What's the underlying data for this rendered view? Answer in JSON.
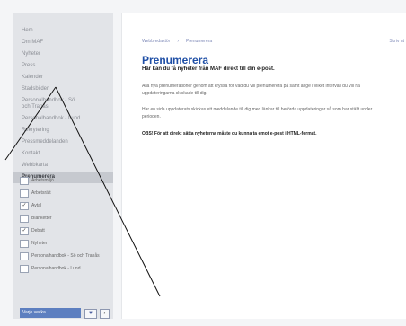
{
  "sidebar": {
    "items": [
      {
        "label": "Hem"
      },
      {
        "label": "Om MAF"
      },
      {
        "label": "Nyheter"
      },
      {
        "label": "Press"
      },
      {
        "label": "Kalender"
      },
      {
        "label": "Stadsbilder"
      },
      {
        "label": "Personalhandbok - Sö\noch Tranås"
      },
      {
        "label": "Personalhandbok - Lund"
      },
      {
        "label": "Rekrytering"
      },
      {
        "label": "Pressmeddelanden"
      },
      {
        "label": "Kontakt"
      },
      {
        "label": "Webbkarta"
      },
      {
        "label": "Prenumerera"
      }
    ]
  },
  "breadcrumb": {
    "items": [
      "Webbredaktör",
      "Prenumerera"
    ]
  },
  "corner_link": "Skriv ut",
  "main": {
    "title": "Prenumerera",
    "lead": "Här kan du få nyheter från MAF direkt till din e-post.",
    "p1": "Alla nya prenumerationer genom att kryssa för vad du vill prenumerera på samt ange i vilket intervall du vill ha uppdateringarna skickade till dig.",
    "p2": "Har en sida uppdaterats skickas ett meddelande till dig med länkar till berörda uppdateringar så som har ställt under perioden.",
    "p3": "OBS! För att direkt sätta nyheterna måste du kunna ta emot e-post i HTML-format."
  },
  "options": [
    {
      "label": "Arbetsmiljö",
      "checked": false
    },
    {
      "label": "Arbetsrätt",
      "checked": false
    },
    {
      "label": "Avtal",
      "checked": true
    },
    {
      "label": "Blanketter",
      "checked": false
    },
    {
      "label": "Debatt",
      "checked": true
    },
    {
      "label": "Nyheter",
      "checked": false
    },
    {
      "label": "Personalhandbok - Sö och Tranås",
      "checked": false
    },
    {
      "label": "Personalhandbok - Lund",
      "checked": false
    }
  ],
  "subscribe": {
    "interval_value": "Varje vecka",
    "arrow_icon": "chevron-down-icon",
    "go_icon": "arrow-right-icon"
  },
  "colors": {
    "title": "#1f4fa6",
    "active_nav": "#c6c9cf",
    "select": "#5d7fc0"
  }
}
